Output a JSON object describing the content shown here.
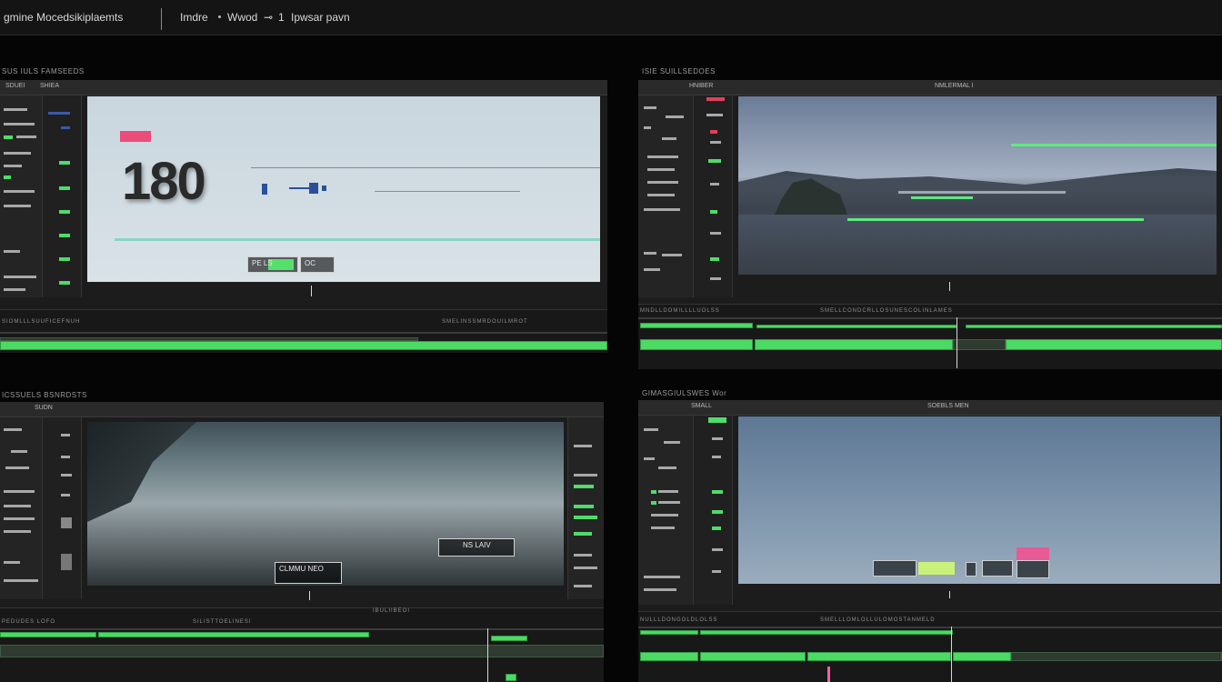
{
  "topbar": {
    "title": "gmine Mocedsikiplaemts",
    "items": [
      "Imdre",
      "Wwod",
      "1",
      "Ipwsar pavn"
    ]
  },
  "panels": [
    {
      "caption": "SUS IULS FAMSEEDS",
      "header_tabs": [
        "SDUEI",
        "SHIEA"
      ],
      "timeline_labels": [
        "SIOMLLLSUUFICEFNUH",
        "SMELINSSMRDOUILMROT"
      ],
      "viewer": {
        "big_number": "180",
        "box_label_a": "PE LS",
        "box_label_b": "OC"
      }
    },
    {
      "caption": "ISIE SUILLSEDOES",
      "header_tabs": [
        "HNIBER"
      ],
      "header_right": "NMLERMAL I",
      "timeline_labels": [
        "MNDLLDOMILLLLUOLSS",
        "SMELLCONDCRLLOSUNESCOLINLAMES"
      ]
    },
    {
      "caption": "ICSSUELS BSNRDSTS",
      "header_tabs": [
        "SUDN"
      ],
      "timeline_labels": [
        "PEDUDES LOFO",
        "SILISTTOELINESI",
        "IBULIIBEOI"
      ],
      "viewer": {
        "box_label_a": "NS LAIV",
        "box_label_b": "CLMMU NEO"
      }
    },
    {
      "caption": "GIMASGIULSWES Wor",
      "header_tabs": [
        "SMALL"
      ],
      "header_right": "SOEBLS MEN",
      "timeline_labels": [
        "NULLLDONGOLDLOLSS",
        "SMELLLOMLOLLULOMOSTANMELD"
      ]
    }
  ],
  "colors": {
    "accent_green": "#4cd964",
    "accent_pink": "#ea4d7a",
    "panel_bg": "#1c1c1c",
    "app_bg": "#050505"
  }
}
